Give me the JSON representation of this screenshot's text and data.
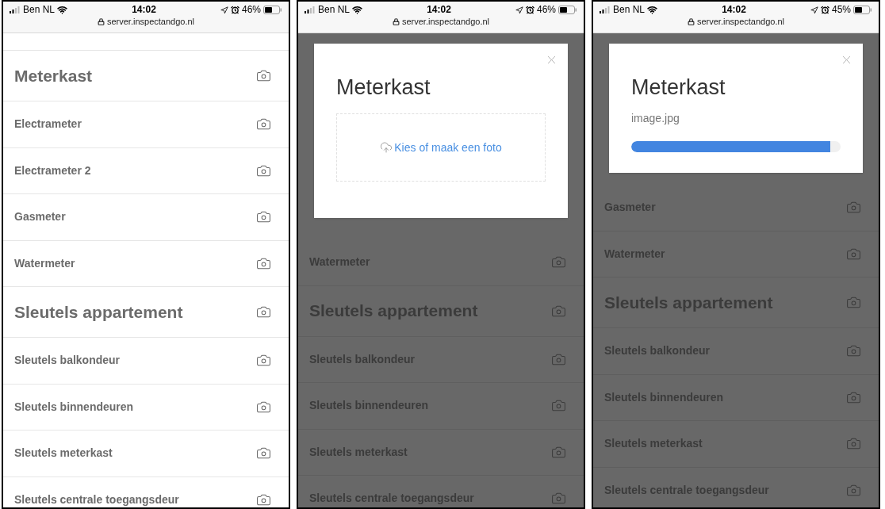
{
  "screens": [
    {
      "status": {
        "carrier": "Ben NL",
        "time": "14:02",
        "battery": "46%",
        "url": "server.inspectandgo.nl"
      },
      "rows": [
        {
          "kind": "section",
          "label": "Meterkast"
        },
        {
          "kind": "item",
          "label": "Electrameter"
        },
        {
          "kind": "item",
          "label": "Electrameter 2"
        },
        {
          "kind": "item",
          "label": "Gasmeter"
        },
        {
          "kind": "item",
          "label": "Watermeter"
        },
        {
          "kind": "section",
          "label": "Sleutels appartement"
        },
        {
          "kind": "item",
          "label": "Sleutels balkondeur"
        },
        {
          "kind": "item",
          "label": "Sleutels binnendeuren"
        },
        {
          "kind": "item",
          "label": "Sleutels meterkast"
        },
        {
          "kind": "item",
          "label": "Sleutels centrale toegangsdeur"
        }
      ]
    },
    {
      "status": {
        "carrier": "Ben NL",
        "time": "14:02",
        "battery": "46%",
        "url": "server.inspectandgo.nl"
      },
      "modal": {
        "kind": "upload",
        "title": "Meterkast",
        "upload_label": "Kies of maak een foto"
      },
      "rows": [
        {
          "kind": "item",
          "label": "Watermeter"
        },
        {
          "kind": "section",
          "label": "Sleutels appartement"
        },
        {
          "kind": "item",
          "label": "Sleutels balkondeur"
        },
        {
          "kind": "item",
          "label": "Sleutels binnendeuren"
        },
        {
          "kind": "item",
          "label": "Sleutels meterkast"
        },
        {
          "kind": "item",
          "label": "Sleutels centrale toegangsdeur"
        }
      ]
    },
    {
      "status": {
        "carrier": "Ben NL",
        "time": "14:02",
        "battery": "45%",
        "url": "server.inspectandgo.nl"
      },
      "modal": {
        "kind": "progress",
        "title": "Meterkast",
        "file_name": "image.jpg",
        "level": 0.95
      },
      "rows": [
        {
          "kind": "item",
          "label": "Gasmeter"
        },
        {
          "kind": "item",
          "label": "Watermeter"
        },
        {
          "kind": "section",
          "label": "Sleutels appartement"
        },
        {
          "kind": "item",
          "label": "Sleutels balkondeur"
        },
        {
          "kind": "item",
          "label": "Sleutels binnendeuren"
        },
        {
          "kind": "item",
          "label": "Sleutels meterkast"
        },
        {
          "kind": "item",
          "label": "Sleutels centrale toegangsdeur"
        }
      ]
    }
  ]
}
